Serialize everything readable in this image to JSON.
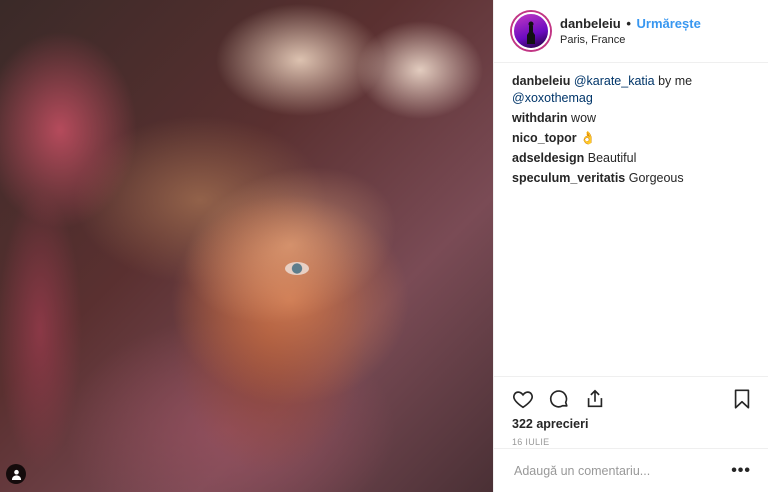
{
  "post": {
    "author": "danbeleiu",
    "separator": "•",
    "follow_label": "Urmărește",
    "location": "Paris, France",
    "caption": {
      "username": "danbeleiu",
      "mention1": "@karate_katia",
      "text": " by me ",
      "mention2": "@xoxothemag"
    },
    "comments": [
      {
        "user": "withdarin",
        "text": "wow"
      },
      {
        "user": "nico_topor",
        "text": "👌"
      },
      {
        "user": "adseldesign",
        "text": "Beautiful"
      },
      {
        "user": "speculum_veritatis",
        "text": "Gorgeous"
      }
    ],
    "likes": "322 aprecieri",
    "date": "16 IULIE",
    "add_comment_placeholder": "Adaugă un comentariu...",
    "more_label": "•••"
  },
  "icons": {
    "like": "heart-icon",
    "comment": "comment-icon",
    "share": "share-icon",
    "save": "bookmark-icon",
    "tag": "user-tag-icon"
  },
  "colors": {
    "follow": "#3897f0",
    "mention": "#003569",
    "text": "#262626",
    "muted": "#999999"
  }
}
